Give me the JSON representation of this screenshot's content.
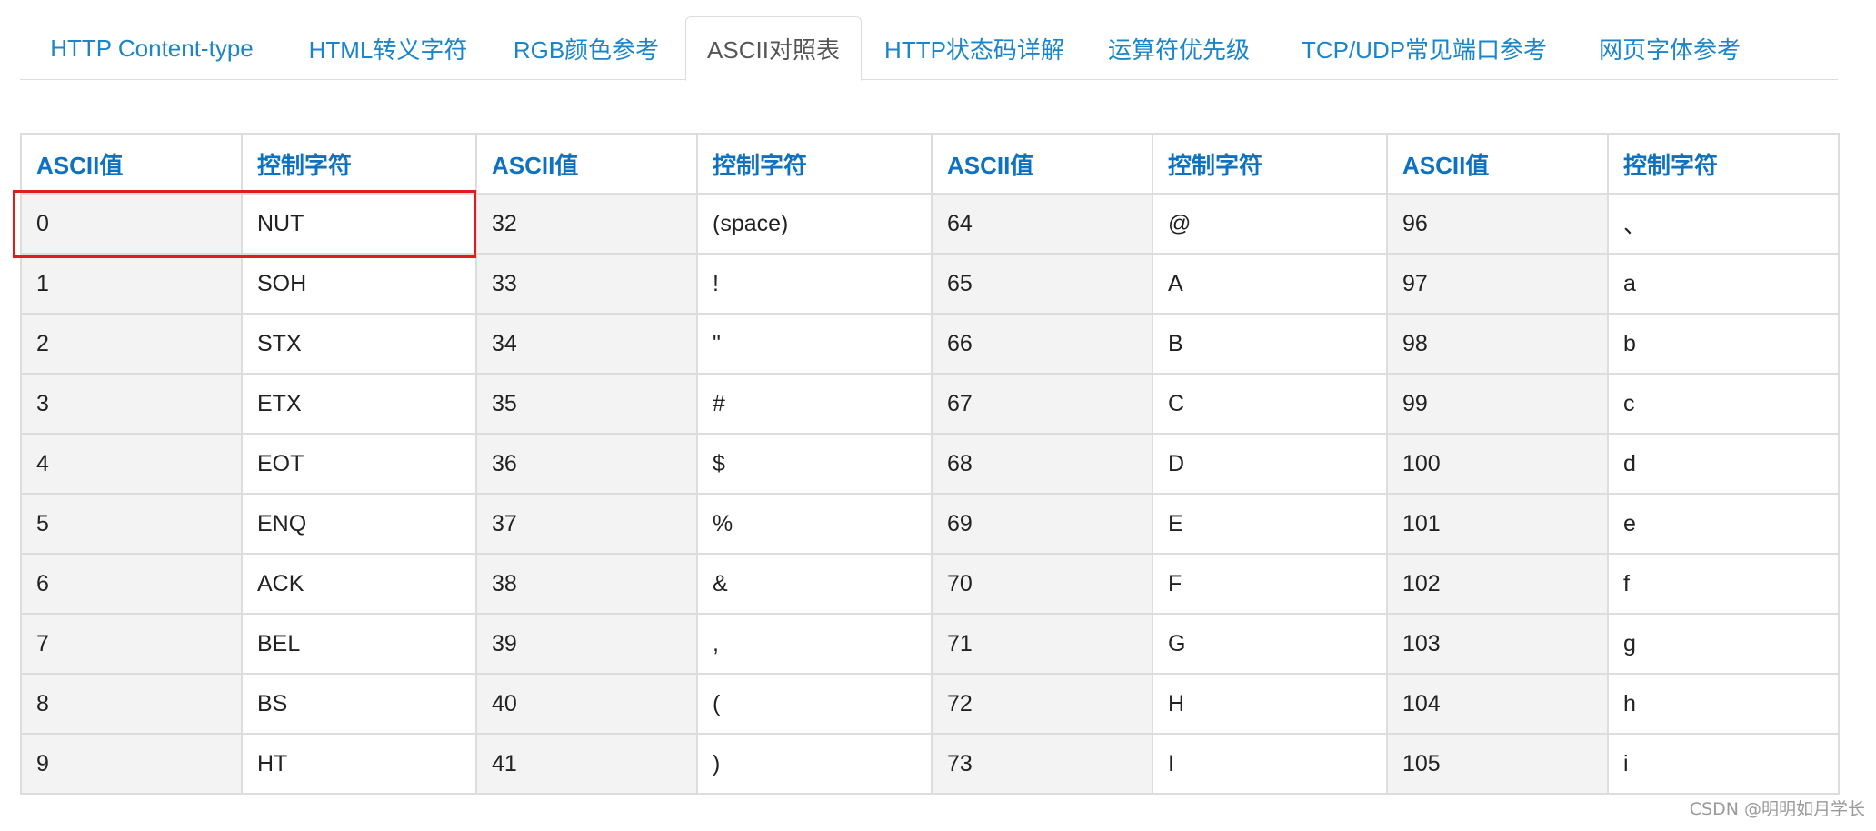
{
  "tabs": [
    {
      "label": "HTTP Content-type"
    },
    {
      "label": "HTML转义字符"
    },
    {
      "label": "RGB颜色参考"
    },
    {
      "label": "ASCII对照表"
    },
    {
      "label": "HTTP状态码详解"
    },
    {
      "label": "运算符优先级"
    },
    {
      "label": "TCP/UDP常见端口参考"
    },
    {
      "label": "网页字体参考"
    }
  ],
  "active_tab": "ASCII对照表",
  "table": {
    "headers": [
      "ASCII值",
      "控制字符",
      "ASCII值",
      "控制字符",
      "ASCII值",
      "控制字符",
      "ASCII值",
      "控制字符"
    ],
    "rows": [
      [
        "0",
        "NUT",
        "32",
        "(space)",
        "64",
        "@",
        "96",
        "、"
      ],
      [
        "1",
        "SOH",
        "33",
        "!",
        "65",
        "A",
        "97",
        "a"
      ],
      [
        "2",
        "STX",
        "34",
        "\"",
        "66",
        "B",
        "98",
        "b"
      ],
      [
        "3",
        "ETX",
        "35",
        "#",
        "67",
        "C",
        "99",
        "c"
      ],
      [
        "4",
        "EOT",
        "36",
        "$",
        "68",
        "D",
        "100",
        "d"
      ],
      [
        "5",
        "ENQ",
        "37",
        "%",
        "69",
        "E",
        "101",
        "e"
      ],
      [
        "6",
        "ACK",
        "38",
        "&",
        "70",
        "F",
        "102",
        "f"
      ],
      [
        "7",
        "BEL",
        "39",
        ",",
        "71",
        "G",
        "103",
        "g"
      ],
      [
        "8",
        "BS",
        "40",
        "(",
        "72",
        "H",
        "104",
        "h"
      ],
      [
        "9",
        "HT",
        "41",
        ")",
        "73",
        "I",
        "105",
        "i"
      ]
    ]
  },
  "watermark": "CSDN @明明如月学长",
  "colors": {
    "link": "#1a85c9",
    "header_text": "#0f72c0",
    "highlight": "#e01c1c",
    "border": "#dddddd",
    "value_cell_bg": "#f3f3f3"
  }
}
